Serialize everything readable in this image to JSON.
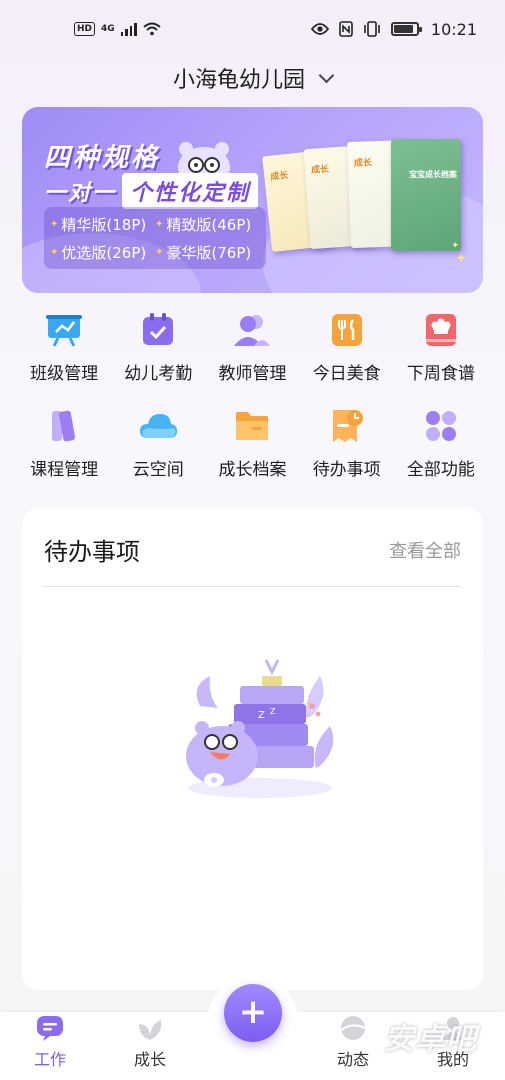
{
  "status_bar": {
    "hd": "HD",
    "network": "4G",
    "time": "10:21",
    "icons": [
      "eye-icon",
      "nfc-icon",
      "vibrate-icon",
      "battery-icon"
    ]
  },
  "header": {
    "school_name": "小海龟幼儿园"
  },
  "banner": {
    "title": "四种规格",
    "subtitle_part1": "一对一",
    "subtitle_part2": "个性化定制",
    "sizes": [
      "精华版(18P)",
      "精致版(46P)",
      "优选版(26P)",
      "豪华版(76P)"
    ],
    "book_text_1": "成长",
    "book_text_2": "成长",
    "book_text_3": "成长",
    "book_text_4": "宝宝成长档案"
  },
  "functions": [
    {
      "label": "班级管理",
      "icon": "class-management-icon",
      "color": "#3aa7f2"
    },
    {
      "label": "幼儿考勤",
      "icon": "attendance-icon",
      "color": "#8b6cf0"
    },
    {
      "label": "教师管理",
      "icon": "teacher-icon",
      "color": "#9a7cf3"
    },
    {
      "label": "今日美食",
      "icon": "food-icon",
      "color": "#f6a33b"
    },
    {
      "label": "下周食谱",
      "icon": "recipe-icon",
      "color": "#f0676b"
    },
    {
      "label": "课程管理",
      "icon": "course-icon",
      "color": "#9c7df2"
    },
    {
      "label": "云空间",
      "icon": "cloud-icon",
      "color": "#46b4f3"
    },
    {
      "label": "成长档案",
      "icon": "folder-icon",
      "color": "#f6a33b"
    },
    {
      "label": "待办事项",
      "icon": "todo-icon",
      "color": "#f6a33b"
    },
    {
      "label": "全部功能",
      "icon": "all-functions-icon",
      "color": "#9c7df2"
    }
  ],
  "todo": {
    "title": "待办事项",
    "more": "查看全部"
  },
  "tabbar": {
    "tabs": [
      {
        "label": "工作",
        "icon": "work-icon",
        "active": true
      },
      {
        "label": "成长",
        "icon": "growth-icon",
        "active": false
      },
      {
        "label": "动态",
        "icon": "moments-icon",
        "active": false
      },
      {
        "label": "我的",
        "icon": "profile-icon",
        "active": false
      }
    ],
    "fab_icon": "plus-icon"
  },
  "watermark": "安卓吧",
  "colors": {
    "accent": "#7c5df2",
    "banner": "#a895f6"
  }
}
